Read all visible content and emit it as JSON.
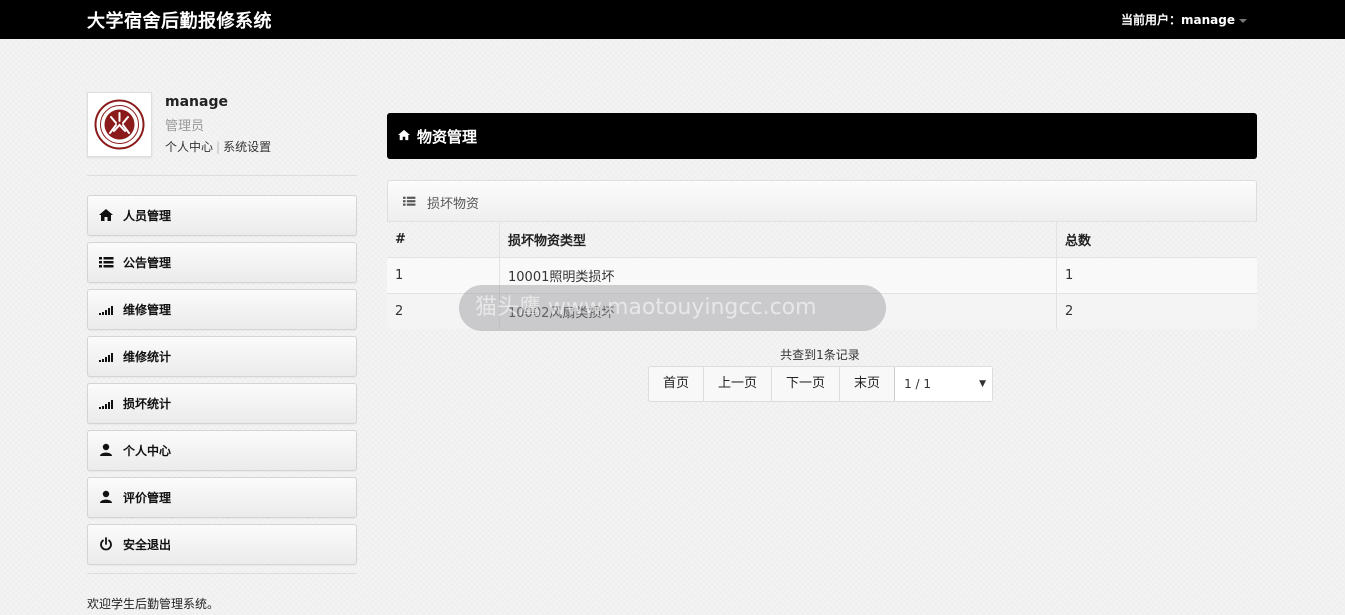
{
  "topbar": {
    "brand": "大学宿舍后勤报修系统",
    "current_user_label": "当前用户：manage"
  },
  "profile": {
    "name": "manage",
    "role": "管理员",
    "link_center": "个人中心",
    "link_settings": "系统设置",
    "link_sep": "|"
  },
  "sidebar": {
    "items": [
      {
        "label": "人员管理",
        "icon": "home-icon"
      },
      {
        "label": "公告管理",
        "icon": "list-icon"
      },
      {
        "label": "维修管理",
        "icon": "signal-icon"
      },
      {
        "label": "维修统计",
        "icon": "signal-icon"
      },
      {
        "label": "损坏统计",
        "icon": "signal-icon"
      },
      {
        "label": "个人中心",
        "icon": "user-icon"
      },
      {
        "label": "评价管理",
        "icon": "user-icon"
      },
      {
        "label": "安全退出",
        "icon": "power-icon"
      }
    ]
  },
  "footer": {
    "welcome": "欢迎学生后勤管理系统。"
  },
  "main": {
    "header_title": "物资管理",
    "panel_title": "损坏物资",
    "table": {
      "columns": [
        "#",
        "损坏物资类型",
        "总数"
      ],
      "rows": [
        [
          "1",
          "10001照明类损坏",
          "1"
        ],
        [
          "2",
          "10002风扇类损坏",
          "2"
        ]
      ]
    },
    "pagination": {
      "records_text": "共查到1条记录",
      "first": "首页",
      "prev": "上一页",
      "next": "下一页",
      "last": "末页",
      "page_select": "1 / 1",
      "select_arrow": "▼"
    }
  },
  "watermark": {
    "text": "猫头鹰 www.maotouyingcc.com"
  },
  "colors": {
    "topbar_bg": "#000000",
    "header_bg": "#000000",
    "logo_red": "#8b1a1a"
  }
}
